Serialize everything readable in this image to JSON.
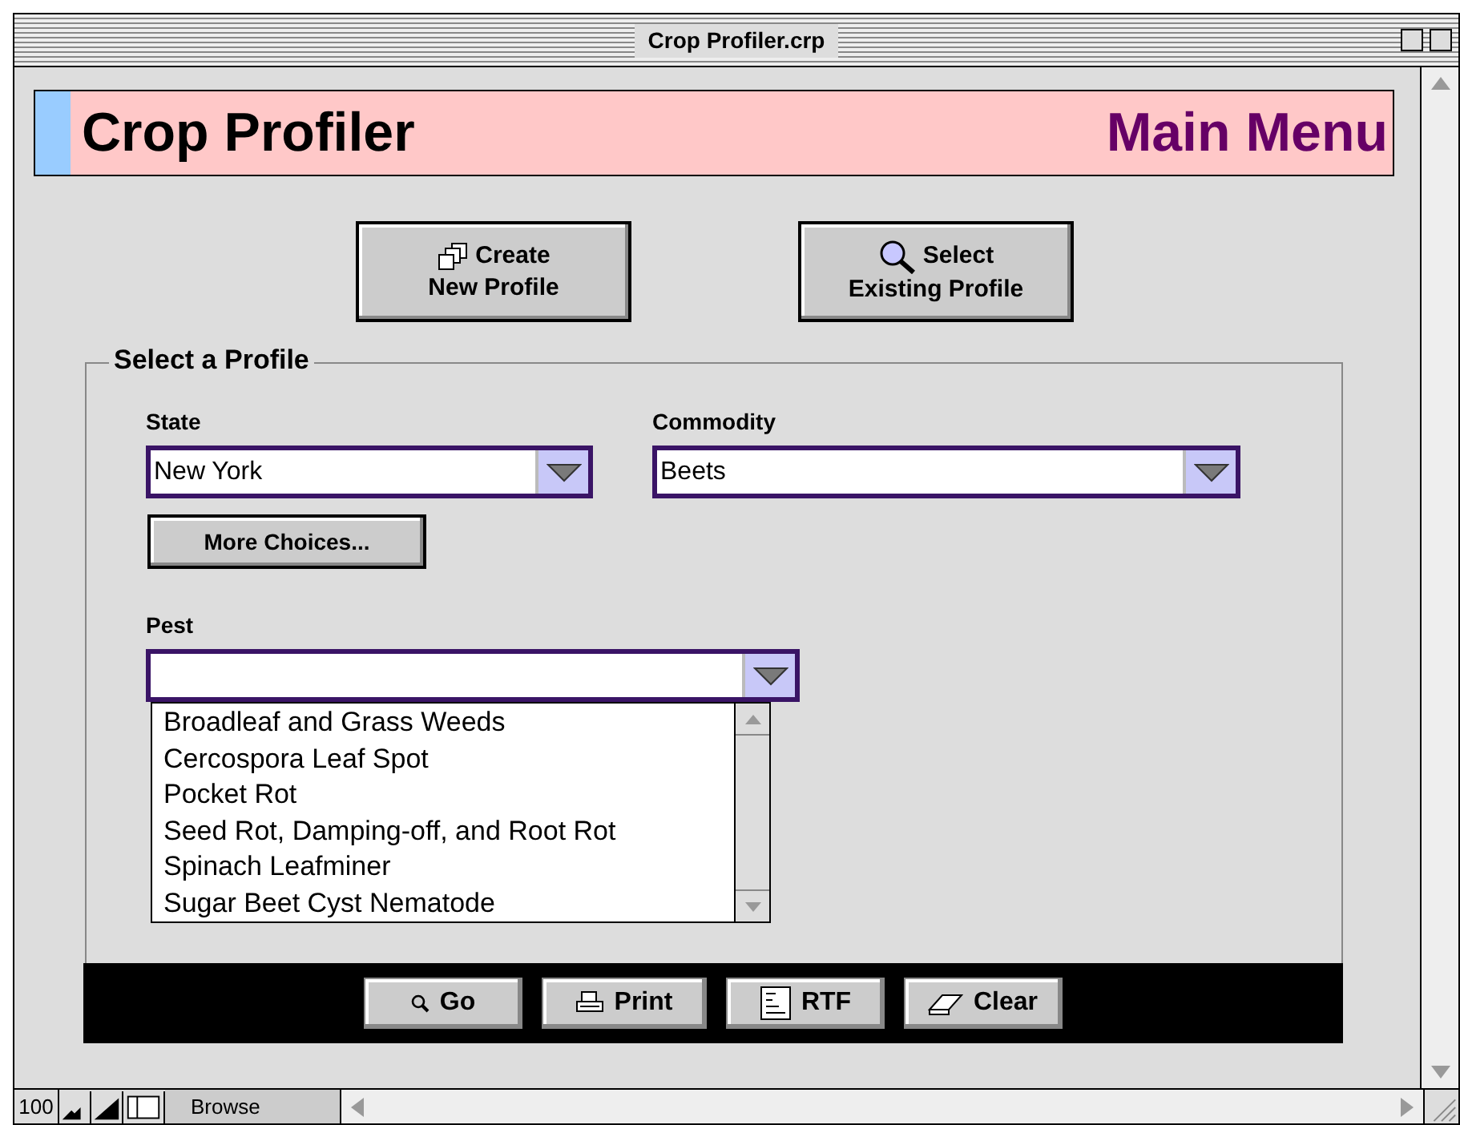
{
  "window": {
    "title": "Crop Profiler.crp"
  },
  "header": {
    "title": "Crop Profiler",
    "subtitle": "Main Menu"
  },
  "top_buttons": [
    {
      "kind": "create",
      "lines": [
        "Create",
        "New Profile"
      ]
    },
    {
      "kind": "select",
      "lines": [
        "Select",
        "Existing Profile"
      ]
    }
  ],
  "profile_group": {
    "title": "Select a Profile",
    "state": {
      "label": "State",
      "value": "New York"
    },
    "commodity": {
      "label": "Commodity",
      "value": "Beets"
    },
    "more_button": "More Choices...",
    "pest": {
      "label": "Pest",
      "expanded": true,
      "options": [
        "Broadleaf and Grass Weeds",
        "Cercospora Leaf Spot",
        "Pocket Rot",
        "Seed Rot, Damping-off, and Root Rot",
        "Spinach Leafminer",
        "Sugar Beet Cyst Nematode"
      ]
    }
  },
  "action_buttons": [
    {
      "kind": "go",
      "label": "Go"
    },
    {
      "kind": "print",
      "label": "Print"
    },
    {
      "kind": "rtf",
      "label": "RTF"
    },
    {
      "kind": "clear",
      "label": "Clear"
    }
  ],
  "status_bar": {
    "zoom": "100",
    "mode": "Browse"
  }
}
